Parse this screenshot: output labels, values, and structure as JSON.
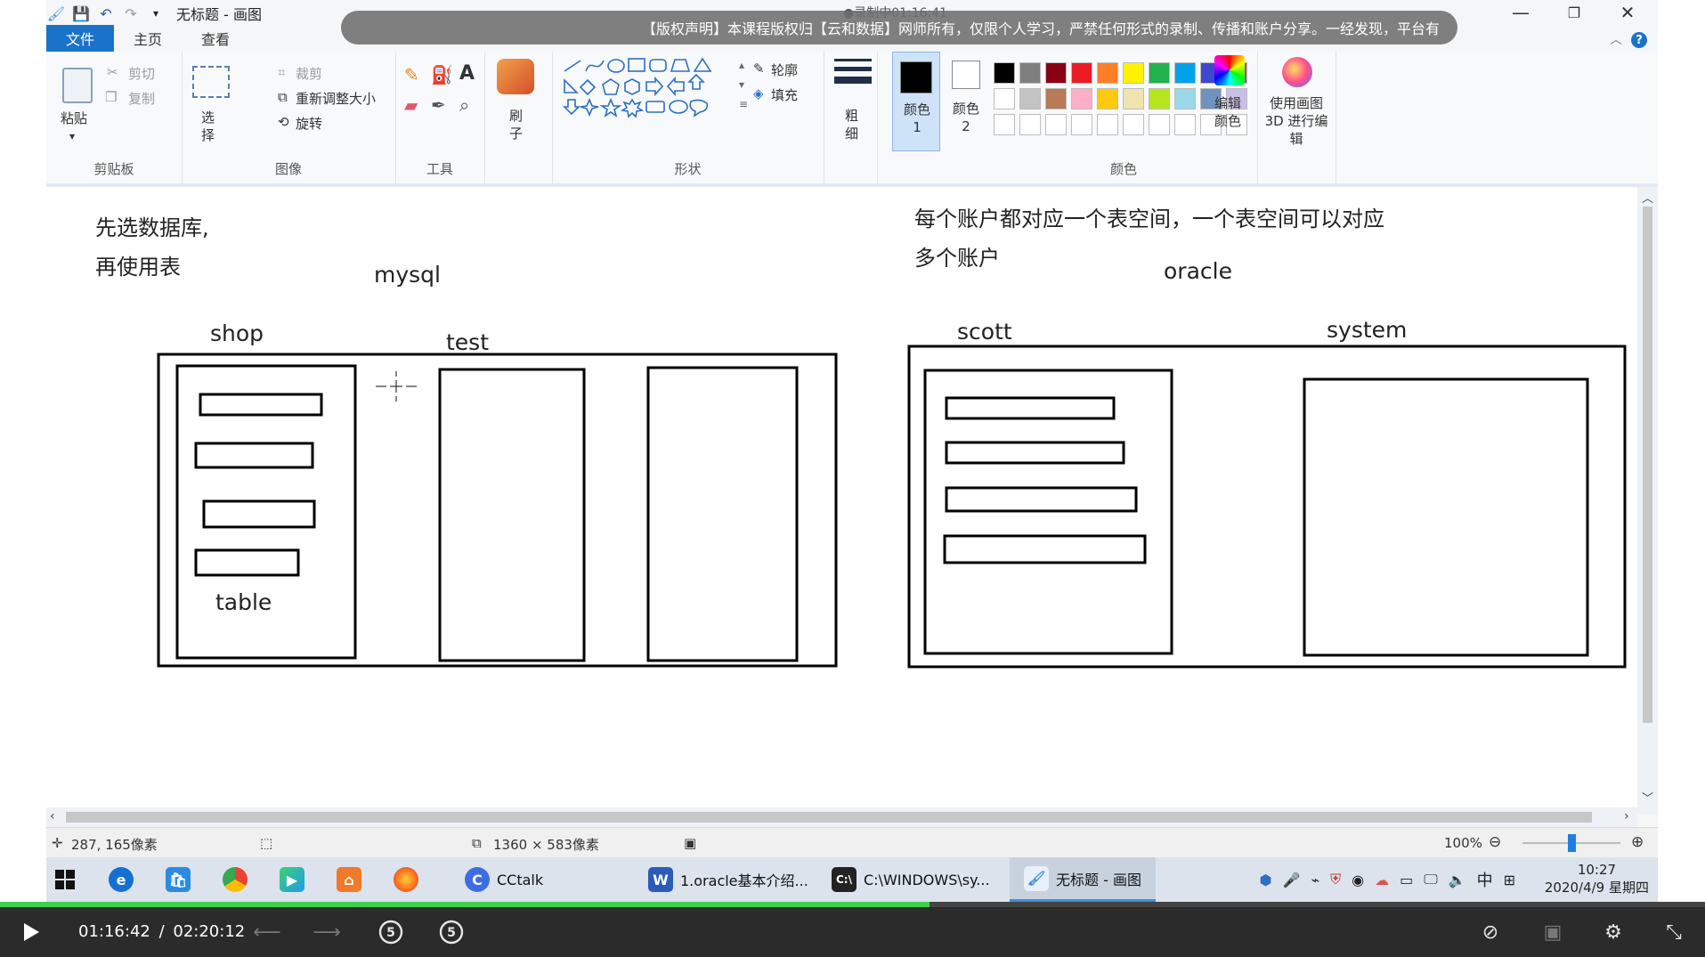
{
  "window": {
    "title": "无标题 - 画图",
    "recording": "●录制中01:16:41",
    "banner": "【版权声明】本课程版权归【云和数据】网师所有，仅限个人学习，严禁任何形式的录制、传播和账户分享。一经发现，平台有"
  },
  "tabs": [
    "文件",
    "主页",
    "查看"
  ],
  "ribbon": {
    "clipboard": {
      "label": "剪贴板",
      "paste": "粘贴",
      "cut": "剪切",
      "copy": "复制"
    },
    "image": {
      "label": "图像",
      "select": "选择",
      "crop": "裁剪",
      "resize": "重新调整大小",
      "rotate": "旋转"
    },
    "tools": {
      "label": "工具"
    },
    "brushes": {
      "label": "刷子"
    },
    "shapes": {
      "label": "形状",
      "outline": "轮廓",
      "fill": "填充"
    },
    "size": {
      "label": "粗细"
    },
    "color1": {
      "label": "颜色 1"
    },
    "color2": {
      "label": "颜色 2"
    },
    "colors": {
      "label": "颜色",
      "edit": "编辑颜色"
    },
    "paint3d": {
      "label": "使用画图 3D 进行编辑"
    },
    "palette_row1": [
      "#000000",
      "#7f7f7f",
      "#880015",
      "#ed1c24",
      "#ff7f27",
      "#fff200",
      "#22b14c",
      "#00a2e8",
      "#3f48cc",
      "#a349a4"
    ],
    "palette_row2": [
      "#ffffff",
      "#c3c3c3",
      "#b97a57",
      "#ffaec9",
      "#ffc90e",
      "#efe4b0",
      "#b5e61d",
      "#99d9ea",
      "#7092be",
      "#c8bfe7"
    ],
    "palette_row3": [
      "#ffffff",
      "#ffffff",
      "#ffffff",
      "#ffffff",
      "#ffffff",
      "#ffffff",
      "#ffffff",
      "#ffffff",
      "#ffffff",
      "#ffffff"
    ]
  },
  "drawing": {
    "note_left_1": "先选数据库,",
    "note_left_2": "再使用表",
    "mysql": "mysql",
    "shop": "shop",
    "test": "test",
    "table": "table",
    "note_right_1": "每个账户都对应一个表空间，一个表空间可以对应",
    "note_right_2": "多个账户",
    "oracle": "oracle",
    "scott": "scott",
    "system": "system"
  },
  "status": {
    "cursor": "287, 165像素",
    "size": "1360 × 583像素",
    "zoom": "100%"
  },
  "taskbar": {
    "apps": [
      "CCtalk",
      "1.oracle基本介绍...",
      "C:\\WINDOWS\\sy...",
      "无标题 - 画图"
    ],
    "ime": "中",
    "time": "10:27",
    "date": "2020/4/9 星期四"
  },
  "player": {
    "current": "01:16:42",
    "separator": "/",
    "total": "02:20:12",
    "progress": 0.545
  }
}
